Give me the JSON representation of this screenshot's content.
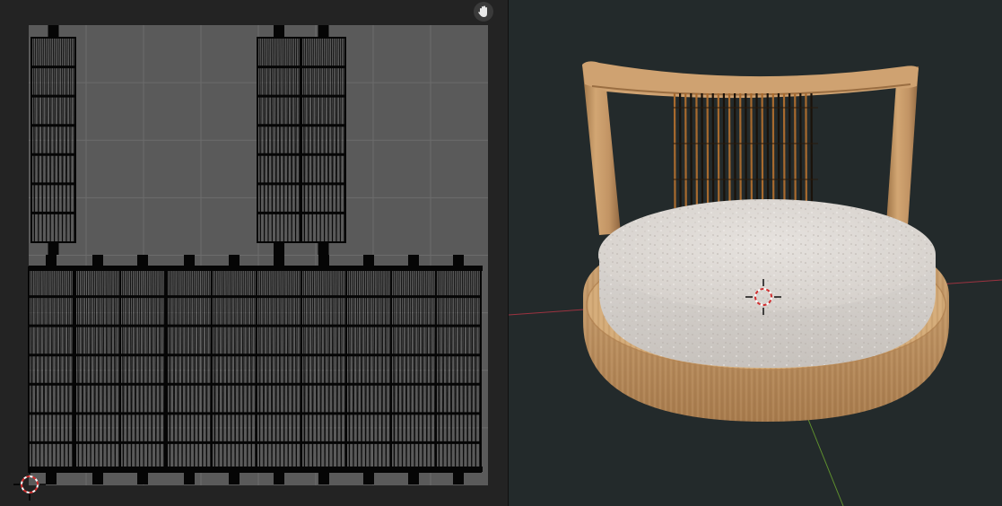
{
  "uv_editor": {
    "tools": {
      "pan": {
        "icon": "hand-icon"
      }
    },
    "cursor": {
      "icon": "3d-cursor-icon"
    }
  },
  "viewport": {
    "object": "chair",
    "cursor": {
      "icon": "3d-cursor-icon"
    },
    "axes": {
      "x_color": "#9c3340",
      "y_color": "#5e8f2e"
    }
  },
  "colors": {
    "uv_grid_bg": "#5a5a5a",
    "uv_mesh": "#050505",
    "viewport_bg": "#232a2b",
    "wood": "#c99d6a",
    "cushion": "#dcd8d4"
  }
}
